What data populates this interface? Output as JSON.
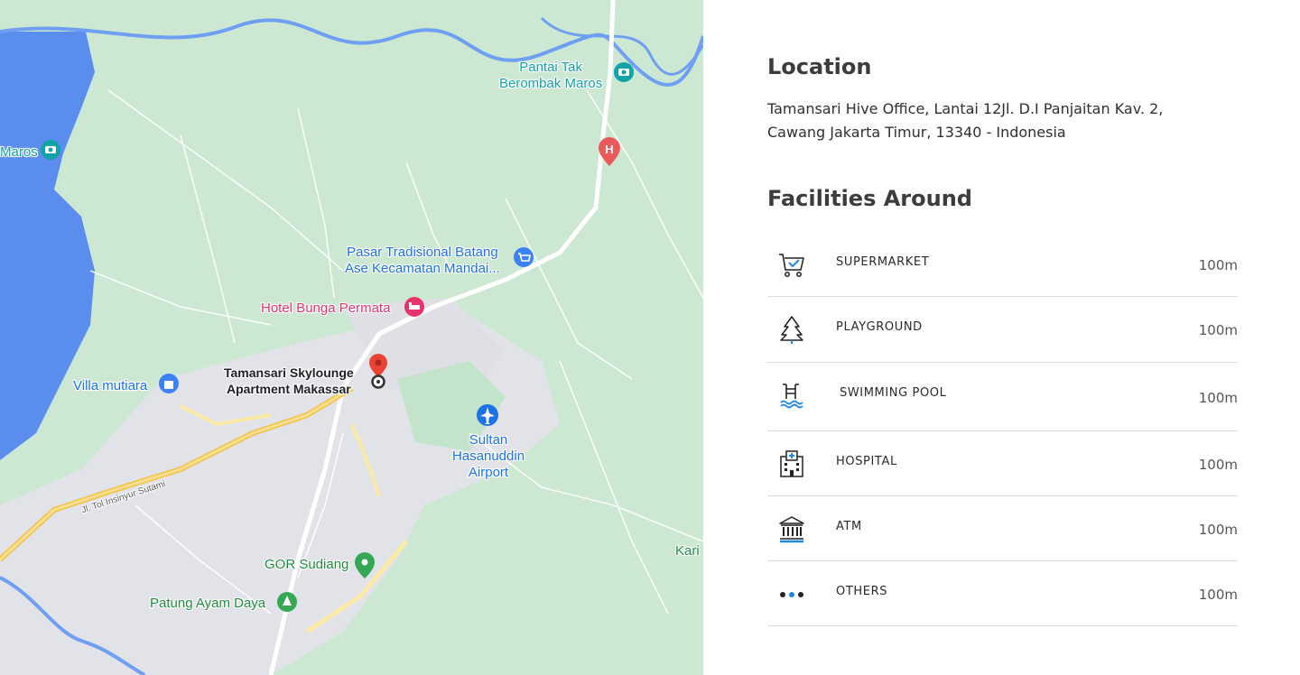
{
  "map": {
    "labels": {
      "pantai_tak": "Pantai Tak\nBerombak Maros",
      "maros": "Maros",
      "pasar": "Pasar Tradisional Batang\nAse Kecamatan Mandai...",
      "hotel": "Hotel Bunga Permata",
      "tamansari": "Tamansari Skylounge\nApartment Makassar",
      "villa": "Villa mutiara",
      "airport": "Sultan\nHasanuddin\nAirport",
      "road": "Jl. Tol Insinyur Sutami",
      "gor": "GOR Sudiang",
      "patung": "Patung Ayam Daya",
      "kari": "Kari"
    },
    "colors": {
      "water": "#5b8def",
      "land": "#c8e6cf",
      "urban": "#e3e4ea",
      "highway": "#f6c955",
      "marker": "#ea4335"
    }
  },
  "location": {
    "title": "Location",
    "address": "Tamansari Hive Office, Lantai 12Jl. D.I Panjaitan Kav. 2, Cawang Jakarta Timur, 13340 - Indonesia"
  },
  "facilities": {
    "title": "Facilities Around",
    "items": [
      {
        "name": "SUPERMARKET",
        "distance": "100m",
        "icon": "cart-icon"
      },
      {
        "name": "PLAYGROUND",
        "distance": "100m",
        "icon": "tree-icon"
      },
      {
        "name": "SWIMMING POOL",
        "distance": "100m",
        "icon": "pool-icon"
      },
      {
        "name": "HOSPITAL",
        "distance": "100m",
        "icon": "hospital-icon"
      },
      {
        "name": "ATM",
        "distance": "100m",
        "icon": "bank-icon"
      },
      {
        "name": "OTHERS",
        "distance": "100m",
        "icon": "dots-icon"
      }
    ],
    "accent": "#1e88e5"
  }
}
